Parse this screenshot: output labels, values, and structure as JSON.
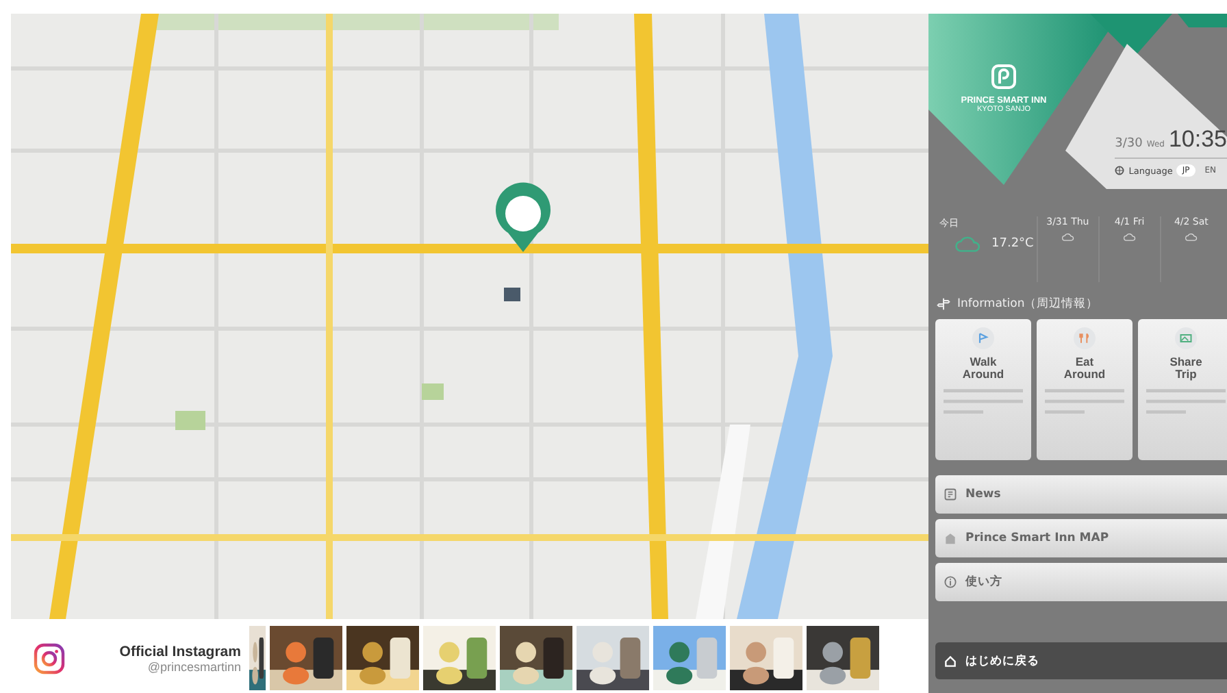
{
  "instagram": {
    "title": "Official Instagram",
    "handle": "@princesmartinn"
  },
  "brand": {
    "name": "PRINCE SMART INN",
    "location": "KYOTO SANJO"
  },
  "clock": {
    "date": "3/30",
    "weekday": "Wed",
    "time": "10:35"
  },
  "language": {
    "label": "Language",
    "options": [
      {
        "label": "JP",
        "selected": true
      },
      {
        "label": "EN",
        "selected": false
      }
    ]
  },
  "weather": [
    {
      "day": "今日",
      "temp": "17.2°C",
      "today": true
    },
    {
      "day": "3/31 Thu",
      "today": false
    },
    {
      "day": "4/1 Fri",
      "today": false
    },
    {
      "day": "4/2 Sat",
      "today": false
    }
  ],
  "information": {
    "title": "Information（周辺情報）",
    "cards": [
      {
        "title": "Walk Around",
        "kind": "walk"
      },
      {
        "title": "Eat Around",
        "kind": "eat"
      },
      {
        "title": "Share Trip",
        "kind": "share"
      }
    ]
  },
  "menu": [
    {
      "label": "News",
      "kind": "news"
    },
    {
      "label": "Prince Smart Inn MAP",
      "kind": "map"
    },
    {
      "label": "使い方",
      "kind": "info"
    }
  ],
  "back_button": {
    "label": "はじめに戻る"
  }
}
